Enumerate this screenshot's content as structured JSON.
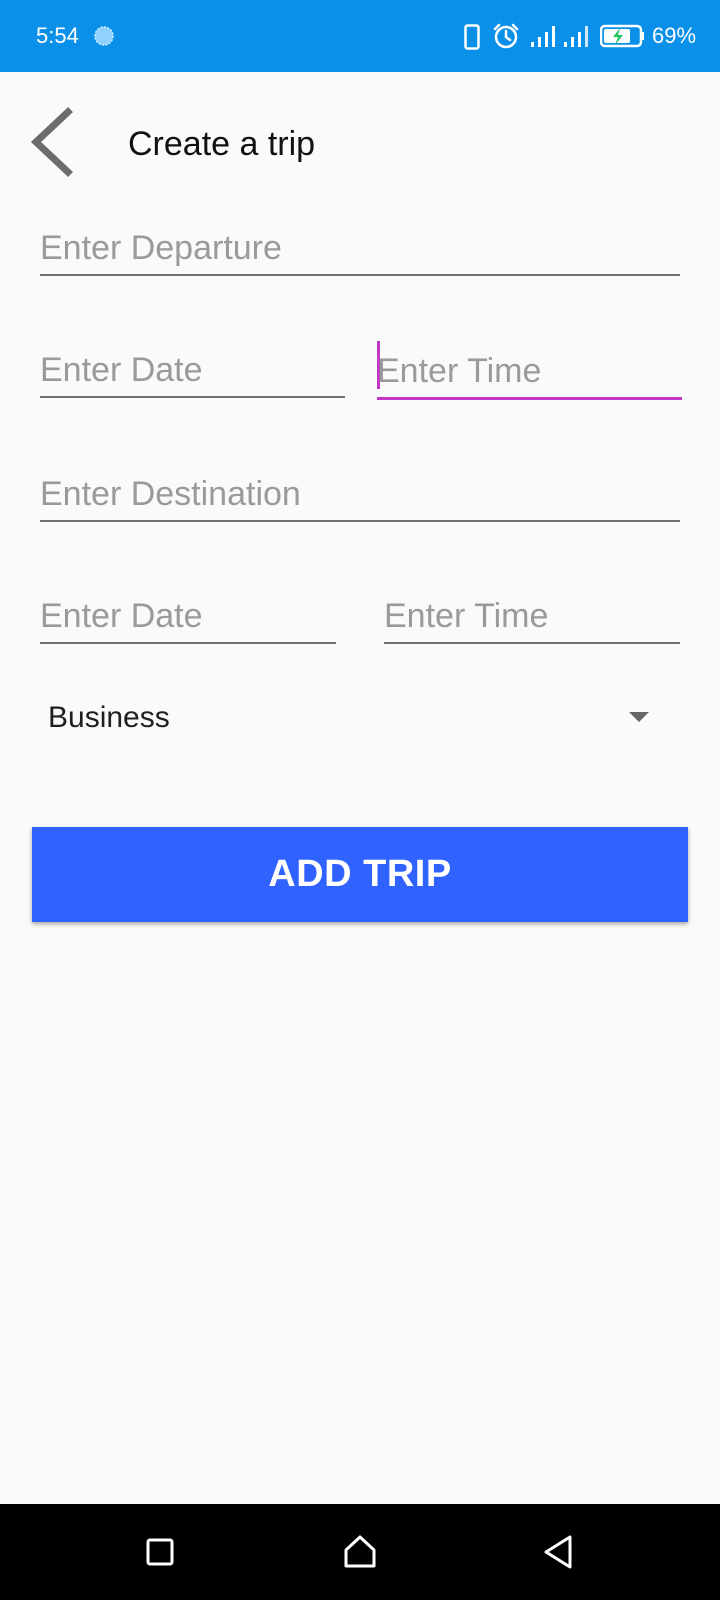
{
  "status_bar": {
    "time": "5:54",
    "battery_percent": "69%",
    "icons": [
      "sync-icon",
      "vibrate-icon",
      "alarm-icon",
      "signal-icon",
      "signal-icon",
      "battery-charging-icon"
    ],
    "background_color": "#0a90e8"
  },
  "header": {
    "title": "Create a trip",
    "back_icon": "chevron-left-icon"
  },
  "form": {
    "departure_placeholder": "Enter Departure",
    "departure_date_placeholder": "Enter Date",
    "departure_time_placeholder": "Enter Time",
    "destination_placeholder": "Enter Destination",
    "destination_date_placeholder": "Enter Date",
    "destination_time_placeholder": "Enter Time",
    "focused_field": "departure_time",
    "focus_color": "#c236c9"
  },
  "trip_type": {
    "selected": "Business",
    "icon": "dropdown-arrow-icon"
  },
  "add_button": {
    "label": "ADD TRIP",
    "color": "#2f62ff"
  },
  "nav_bar": {
    "icons": [
      "recents-icon",
      "home-icon",
      "back-icon"
    ]
  }
}
